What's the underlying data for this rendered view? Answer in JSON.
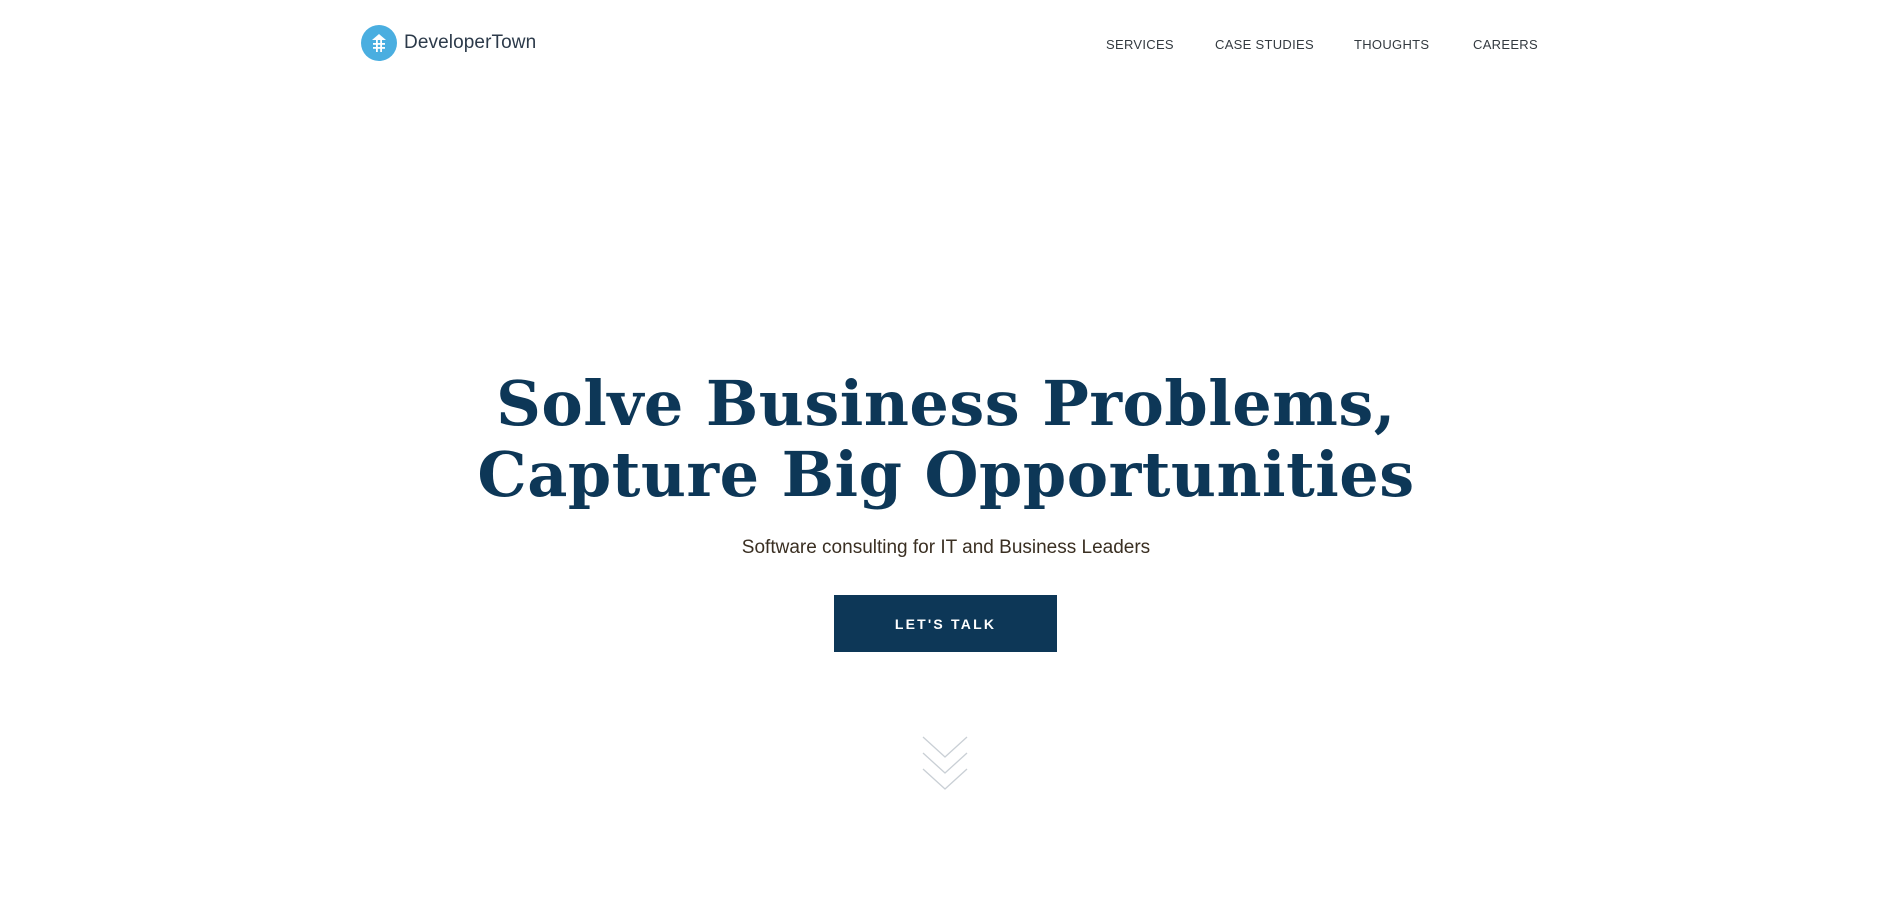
{
  "header": {
    "logo_text": "DeveloperTown",
    "nav": [
      {
        "label": "SERVICES"
      },
      {
        "label": "CASE STUDIES"
      },
      {
        "label": "THOUGHTS"
      },
      {
        "label": "CAREERS"
      }
    ]
  },
  "hero": {
    "title_line1": "Solve Business Problems,",
    "title_line2": "Capture Big Opportunities",
    "subtitle": "Software consulting for IT and Business Leaders",
    "cta_label": "LET'S TALK"
  },
  "icons": {
    "logo": "developertown-logo-icon",
    "scroll": "chevron-down-icon"
  },
  "colors": {
    "brand_navy": "#0d3757",
    "brand_blue": "#4aaee0",
    "nav_text": "#333a40"
  }
}
